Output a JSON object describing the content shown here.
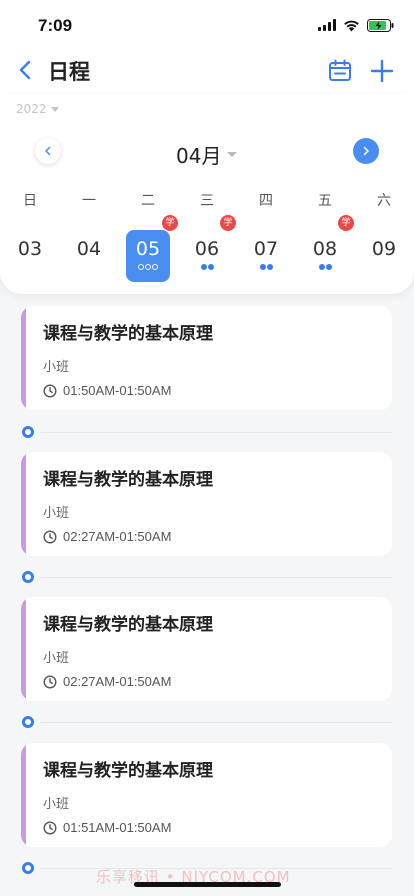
{
  "status_bar": {
    "time": "7:09"
  },
  "header": {
    "title": "日程"
  },
  "calendar": {
    "year": "2022",
    "month": "04月",
    "weekdays": [
      "日",
      "一",
      "二",
      "三",
      "四",
      "五",
      "六"
    ],
    "dates": [
      {
        "day": "03"
      },
      {
        "day": "04"
      },
      {
        "day": "05",
        "selected": true,
        "badge": "学",
        "dots": 3
      },
      {
        "day": "06",
        "badge": "学",
        "dots": 2
      },
      {
        "day": "07",
        "dots": 2
      },
      {
        "day": "08",
        "badge": "学",
        "dots": 2
      },
      {
        "day": "09"
      }
    ]
  },
  "events": [
    {
      "title": "课程与教学的基本原理",
      "class": "小班",
      "time": "01:50AM-01:50AM"
    },
    {
      "title": "课程与教学的基本原理",
      "class": "小班",
      "time": "02:27AM-01:50AM"
    },
    {
      "title": "课程与教学的基本原理",
      "class": "小班",
      "time": "02:27AM-01:50AM"
    },
    {
      "title": "课程与教学的基本原理",
      "class": "小班",
      "time": "01:51AM-01:50AM"
    }
  ],
  "watermark": "乐享移讯 • NIYCOM.COM",
  "colors": {
    "accent": "#4a8df0",
    "stripe": "#c99be0",
    "badge": "#e84a4a",
    "dot": "#3b7de8"
  }
}
